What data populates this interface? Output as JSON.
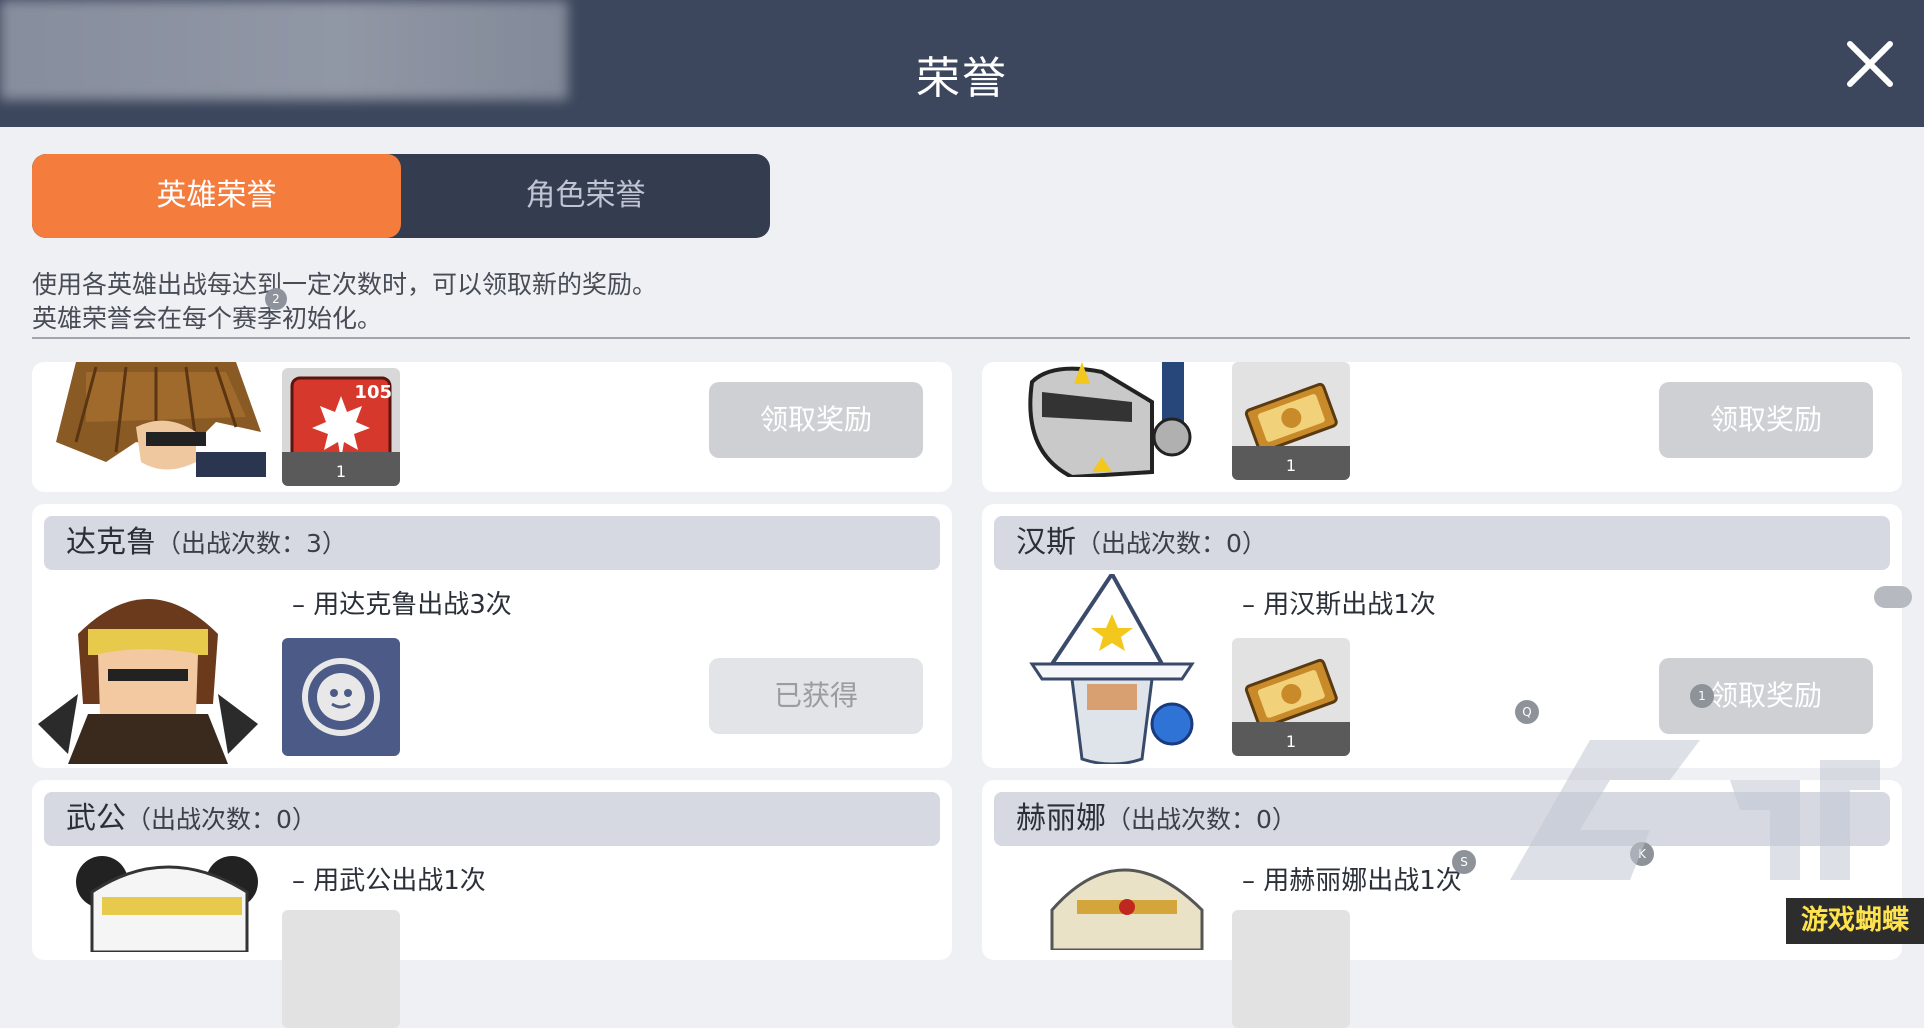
{
  "header": {
    "title": "荣誉"
  },
  "tabs": [
    {
      "label": "英雄荣誉",
      "active": true
    },
    {
      "label": "角色荣誉",
      "active": false
    }
  ],
  "description": {
    "line1": "使用各英雄出战每达到一定次数时，可以领取新的奖励。",
    "line2": "英雄荣誉会在每个赛季初始化。"
  },
  "markers": {
    "page_dot": "2",
    "hans_dot": "1",
    "q_dot": "Q",
    "k_dot": "K",
    "s_dot": "S"
  },
  "cards": [
    {
      "name": "",
      "count": "",
      "task": "",
      "reward_badge": "105",
      "reward_qty": "1",
      "button": "领取奖励",
      "button_state": "claim"
    },
    {
      "name": "",
      "count": "",
      "task": "",
      "reward_qty": "1",
      "button": "领取奖励",
      "button_state": "claim"
    },
    {
      "name": "达克鲁",
      "count": "（出战次数：3）",
      "task": "– 用达克鲁出战3次",
      "button": "已获得",
      "button_state": "obtained"
    },
    {
      "name": "汉斯",
      "count": "（出战次数：0）",
      "task": "– 用汉斯出战1次",
      "reward_qty": "1",
      "button": "领取奖励",
      "button_state": "claim"
    },
    {
      "name": "武公",
      "count": "（出战次数：0）",
      "task": "– 用武公出战1次"
    },
    {
      "name": "赫丽娜",
      "count": "（出战次数：0）",
      "task": "– 用赫丽娜出战1次"
    }
  ],
  "watermark": {
    "badge": "游戏蝴蝶"
  },
  "colors": {
    "header_bg": "#3c465c",
    "tab_active": "#f47c3c",
    "tab_inactive": "#343c4f",
    "button_disabled": "#cfd0d3"
  },
  "icons": [
    "close-icon",
    "maple-leaf-icon",
    "coupon-icon",
    "emblem-icon"
  ]
}
